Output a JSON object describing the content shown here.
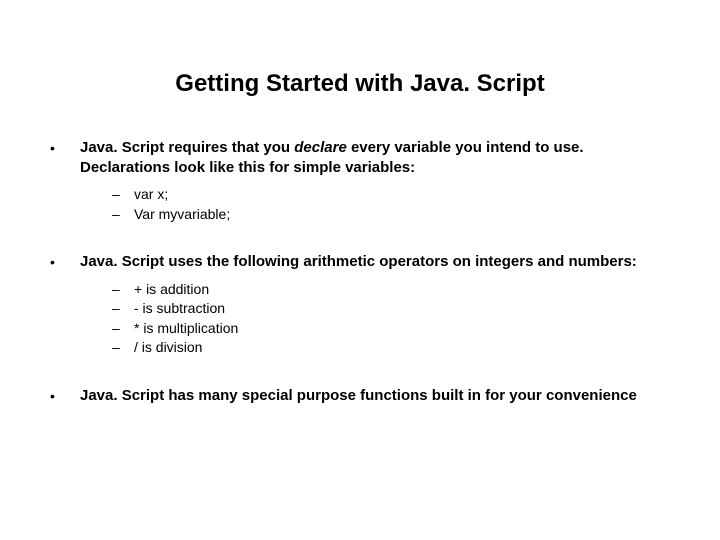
{
  "title": "Getting Started with Java. Script",
  "sections": [
    {
      "text_pre": "Java. Script requires that you ",
      "text_italic": "declare",
      "text_post": " every variable you intend to use.  Declarations look like this for simple variables:",
      "subs": [
        "var x;",
        "Var myvariable;"
      ]
    },
    {
      "text_pre": "Java. Script uses the following arithmetic operators on integers and numbers:",
      "text_italic": "",
      "text_post": "",
      "subs": [
        "+ is addition",
        "- is subtraction",
        "* is multiplication",
        "/ is division"
      ]
    },
    {
      "text_pre": "Java. Script has many special purpose functions built in for your convenience",
      "text_italic": "",
      "text_post": "",
      "subs": []
    }
  ],
  "markers": {
    "bullet": "•",
    "dash": "–"
  }
}
